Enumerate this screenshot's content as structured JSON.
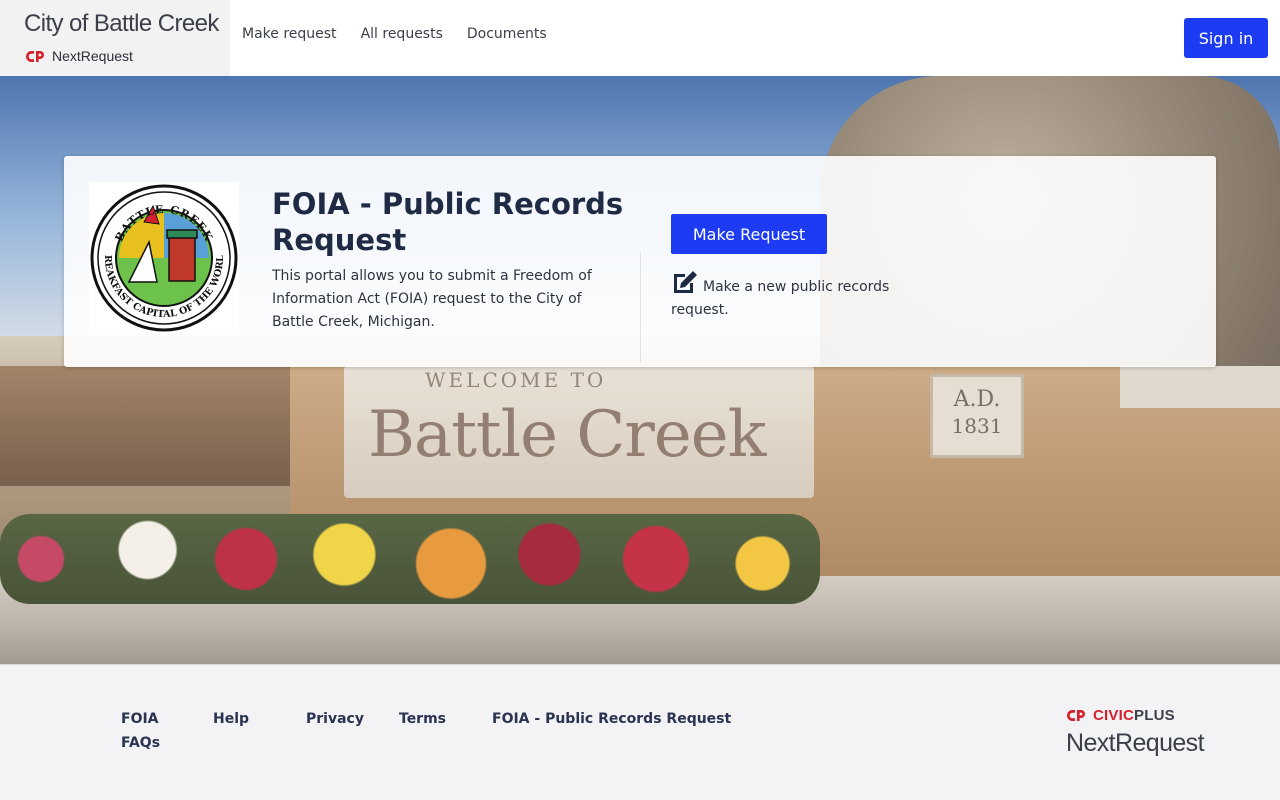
{
  "header": {
    "brand_title": "City of Battle Creek",
    "brand_sub": "NextRequest",
    "nav": [
      "Make request",
      "All requests",
      "Documents"
    ],
    "signin_label": "Sign in"
  },
  "hero": {
    "sign_small": "WELCOME TO",
    "sign_big": "Battle Creek",
    "plaque_line1": "A.D.",
    "plaque_line2": "1831"
  },
  "card": {
    "seal_top": "BATTLE CREEK",
    "seal_bottom": "BREAKFAST CAPITAL OF THE WORLD",
    "title": "FOIA - Public Records Request",
    "description": "This portal allows you to submit a Freedom of Information Act (FOIA) request to the City of Battle Creek, Michigan.",
    "button_label": "Make Request",
    "note": "Make a new public records request."
  },
  "footer": {
    "links": [
      "FOIA FAQs",
      "Help",
      "Privacy",
      "Terms",
      "FOIA - Public Records Request"
    ],
    "civic_brand": "CIVIC",
    "civic_plus": "PLUS",
    "nextrequest": "NextRequest"
  },
  "colors": {
    "accent": "#1c3bf2",
    "civic_red": "#d6202e",
    "text_dark": "#1f2a44"
  },
  "icons": {
    "brand_logo": "civicplus-mark-icon",
    "edit": "edit-note-icon"
  }
}
